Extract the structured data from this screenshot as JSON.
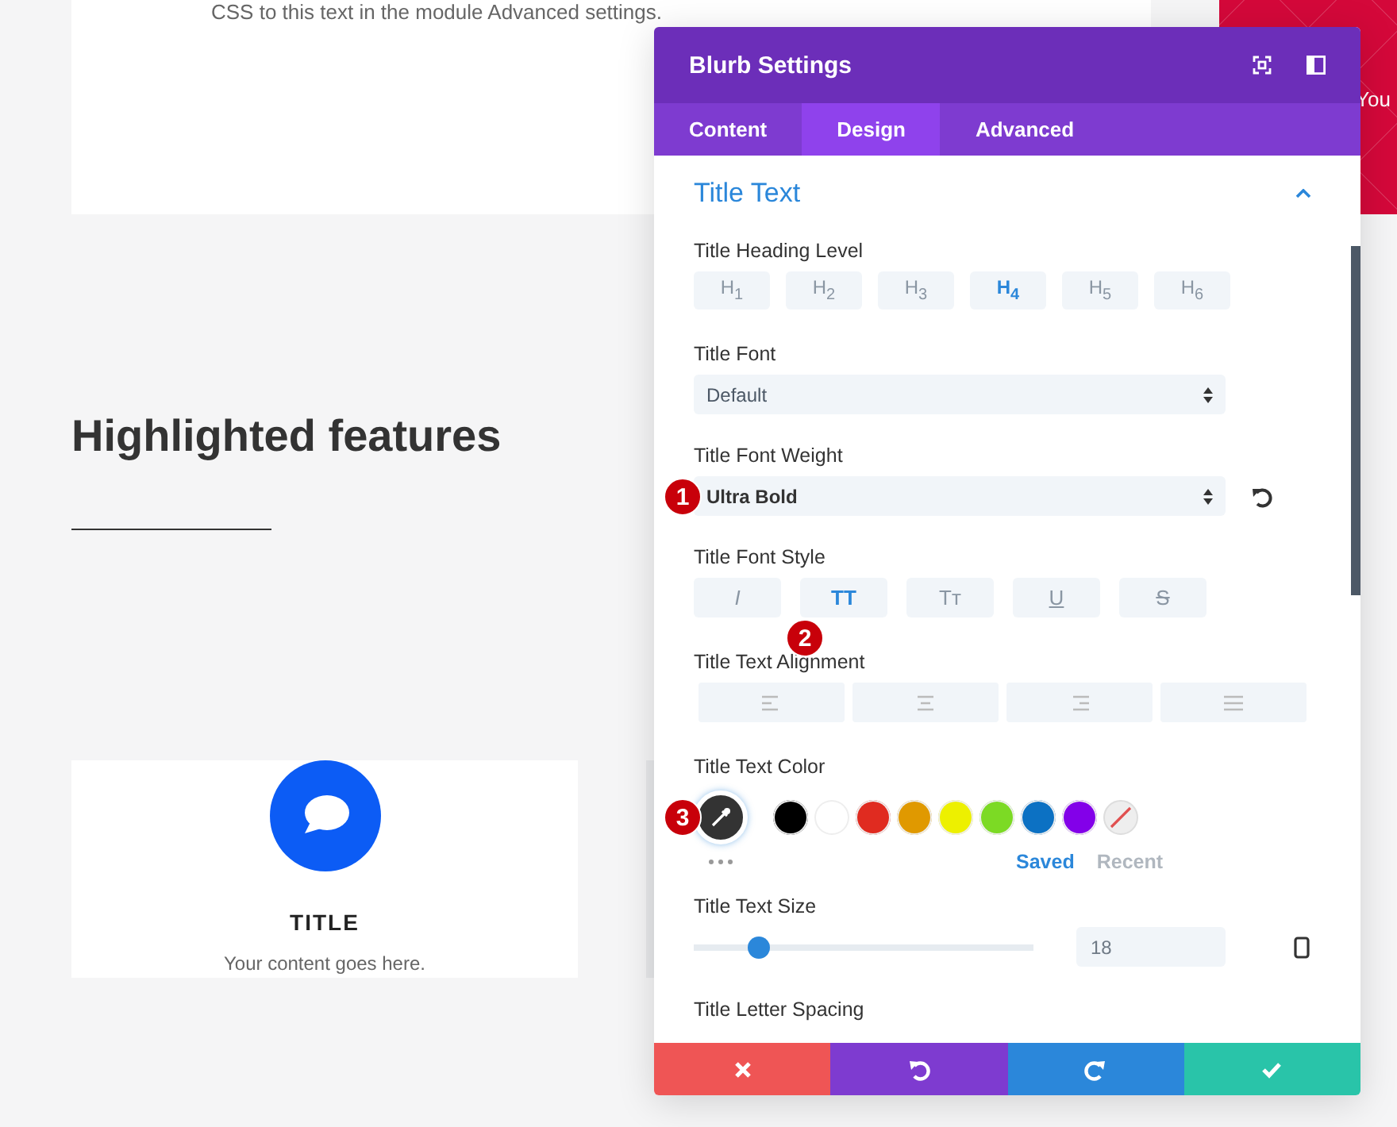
{
  "page": {
    "intro_text": "CSS to this text in the module Advanced settings.",
    "heading": "Highlighted features",
    "promo_text": "You",
    "blurb": {
      "title": "TITLE",
      "body": "Your content goes here."
    }
  },
  "panel": {
    "title": "Blurb Settings",
    "tabs": [
      {
        "label": "Content",
        "selected": false
      },
      {
        "label": "Design",
        "selected": true
      },
      {
        "label": "Advanced",
        "selected": false
      }
    ],
    "section": {
      "title": "Title Text",
      "expanded": true
    },
    "heading_level": {
      "label": "Title Heading Level",
      "options": [
        {
          "label": "H$_{1}$",
          "selected": false
        },
        {
          "label": "H$_{2}$",
          "selected": false
        },
        {
          "label": "H$_{3}$",
          "selected": false
        },
        {
          "label": "H$_{4}$",
          "selected": true
        },
        {
          "label": "H$_{5}$",
          "selected": false
        },
        {
          "label": "H$_{6}$",
          "selected": false
        }
      ]
    },
    "title_font": {
      "label": "Title Font",
      "value": "Default"
    },
    "font_weight": {
      "label": "Title Font Weight",
      "value": "Ultra Bold",
      "marker": "1"
    },
    "font_style": {
      "label": "Title Font Style",
      "marker": "2",
      "options": [
        {
          "kind": "italic",
          "label": "I",
          "selected": false
        },
        {
          "kind": "uppercase",
          "label": "TT",
          "selected": true
        },
        {
          "kind": "smallcaps",
          "label": "Tт",
          "selected": false
        },
        {
          "kind": "underline",
          "label": "U",
          "selected": false
        },
        {
          "kind": "strikethrough",
          "label": "S",
          "selected": false
        }
      ]
    },
    "alignment": {
      "label": "Title Text Alignment",
      "options": [
        {
          "kind": "left"
        },
        {
          "kind": "center"
        },
        {
          "kind": "right"
        },
        {
          "kind": "justify"
        }
      ]
    },
    "text_color": {
      "label": "Title Text Color",
      "marker": "3",
      "swatches": [
        {
          "color": "#000000"
        },
        {
          "color": "#ffffff"
        },
        {
          "color": "#e02b20"
        },
        {
          "color": "#e09900"
        },
        {
          "color": "#edf000"
        },
        {
          "color": "#7cda24"
        },
        {
          "color": "#0c71c3"
        },
        {
          "color": "#8300e9"
        }
      ],
      "tabs": [
        {
          "label": "Saved",
          "selected": true
        },
        {
          "label": "Recent",
          "selected": false
        }
      ]
    },
    "text_size": {
      "label": "Title Text Size",
      "level": 0.19,
      "value": "18"
    },
    "letter_spacing": {
      "label": "Title Letter Spacing"
    },
    "footer": [
      {
        "kind": "cancel"
      },
      {
        "kind": "undo"
      },
      {
        "kind": "redo"
      },
      {
        "kind": "save"
      }
    ]
  }
}
